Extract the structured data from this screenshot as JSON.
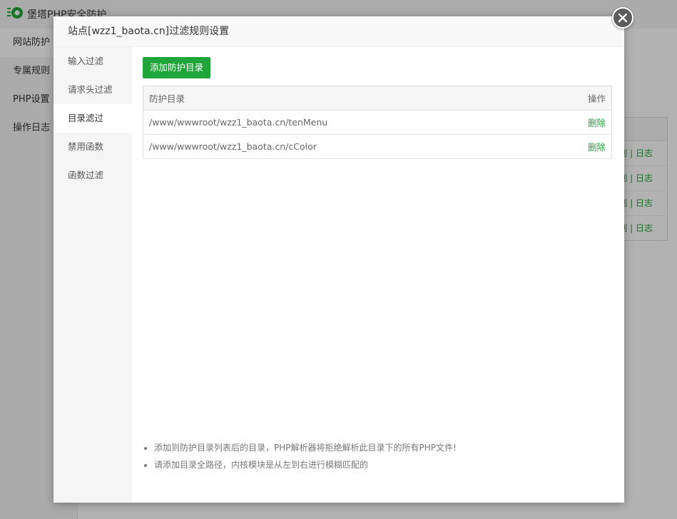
{
  "app": {
    "title": "堡塔PHP安全防护"
  },
  "bg_sidebar": {
    "items": [
      "网站防护",
      "专属规则",
      "PHP设置",
      "操作日志"
    ]
  },
  "bg_table": {
    "row_actions": [
      "则 | 日志",
      "则 | 日志",
      "则 | 日志",
      "则 | 日志"
    ]
  },
  "modal": {
    "title": "站点[wzz1_baota.cn]过滤规则设置",
    "tabs": [
      "输入过滤",
      "请求头过滤",
      "目录滤过",
      "禁用函数",
      "函数过滤"
    ],
    "active_tab": 2,
    "add_button": "添加防护目录",
    "table": {
      "headers": {
        "dir": "防护目录",
        "op": "操作"
      },
      "rows": [
        {
          "dir": "/www/wwwroot/wzz1_baota.cn/tenMenu",
          "op": "删除"
        },
        {
          "dir": "/www/wwwroot/wzz1_baota.cn/cColor",
          "op": "删除"
        }
      ]
    },
    "tips": [
      "添加到防护目录列表后的目录，PHP解析器将拒绝解析此目录下的所有PHP文件!",
      "请添加目录全路径，内核模块是从左到右进行模糊匹配的"
    ]
  },
  "colors": {
    "accent": "#20a53a",
    "close_bg": "#5c5c5c"
  },
  "icons": {
    "close": "close-icon",
    "logo": "logo-icon"
  }
}
